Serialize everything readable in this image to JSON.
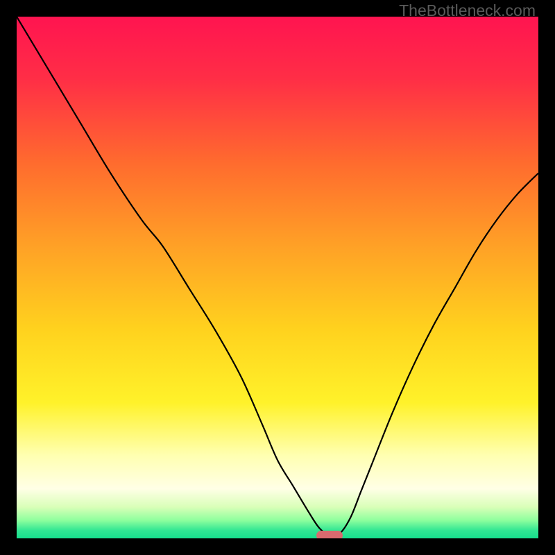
{
  "watermark": "TheBottleneck.com",
  "colors": {
    "frame": "#000000",
    "gradient_stops": [
      {
        "pos": 0.0,
        "color": "#ff1450"
      },
      {
        "pos": 0.12,
        "color": "#ff2e46"
      },
      {
        "pos": 0.28,
        "color": "#ff6b2e"
      },
      {
        "pos": 0.44,
        "color": "#ffa126"
      },
      {
        "pos": 0.6,
        "color": "#ffd21e"
      },
      {
        "pos": 0.74,
        "color": "#fff22a"
      },
      {
        "pos": 0.84,
        "color": "#ffffb0"
      },
      {
        "pos": 0.905,
        "color": "#ffffe6"
      },
      {
        "pos": 0.94,
        "color": "#d9ffb8"
      },
      {
        "pos": 0.965,
        "color": "#8fff9e"
      },
      {
        "pos": 0.985,
        "color": "#30e693"
      },
      {
        "pos": 1.0,
        "color": "#17de8d"
      }
    ],
    "curve": "#000000",
    "mark": "#d96a6f"
  },
  "chart_data": {
    "type": "line",
    "title": "",
    "xlabel": "",
    "ylabel": "",
    "xlim": [
      0,
      100
    ],
    "ylim": [
      0,
      100
    ],
    "grid": false,
    "series": [
      {
        "name": "bottleneck-curve",
        "x": [
          0,
          6,
          12,
          18,
          24,
          28,
          33,
          38,
          43,
          47,
          50,
          53,
          56,
          58,
          60,
          62,
          64,
          66,
          68,
          72,
          76,
          80,
          84,
          88,
          92,
          96,
          100
        ],
        "y": [
          100,
          90,
          80,
          70,
          61,
          56,
          48,
          40,
          31,
          22,
          15,
          10,
          5,
          2,
          0.5,
          1,
          4,
          9,
          14,
          24,
          33,
          41,
          48,
          55,
          61,
          66,
          70
        ]
      }
    ],
    "annotations": [
      {
        "name": "optimal-mark",
        "x": 60,
        "width_pct": 5,
        "color": "#d96a6f"
      }
    ],
    "notes": "V-shaped bottleneck curve over rainbow vertical gradient. Y-axis inverted visually (0 at bottom = green/good, 100 at top = red/bad). Minimum near x≈60."
  }
}
